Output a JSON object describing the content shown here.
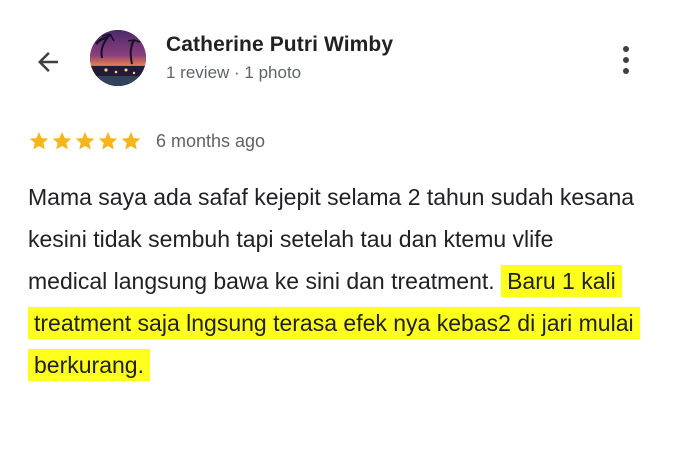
{
  "header": {
    "back_icon": "arrow-back-icon",
    "author_name": "Catherine Putri Wimby",
    "author_meta": "1 review · 1 photo",
    "avatar_icon": "profile-photo-sunset",
    "more_icon": "more-vert-icon"
  },
  "review": {
    "rating": 5,
    "rating_max": 5,
    "star_color": "#F6B61A",
    "time_ago": "6 months ago",
    "text_plain": "Mama saya ada safaf kejepit selama 2 tahun sudah kesana kesini tidak sembuh tapi setelah tau dan ktemu vlife medical langsung bawa ke sini dan treatment.",
    "text_highlighted": "Baru 1 kali treatment saja lngsung terasa efek nya kebas2 di jari mulai berkurang.",
    "highlight_color": "#FFFF1E"
  }
}
